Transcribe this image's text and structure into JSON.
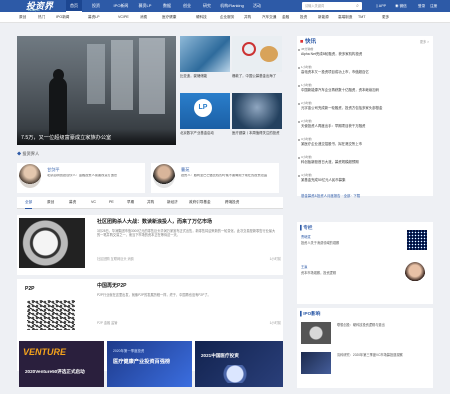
{
  "brand": {
    "logo_text": "投资界",
    "logo_sub": "PEdaily.cn"
  },
  "topnav": {
    "items": [
      "首页",
      "投资",
      "IPO新闻",
      "募资LP",
      "数据",
      "创业",
      "研究",
      "机构/Ranking",
      "活动"
    ],
    "active_index": 0,
    "search_placeholder": "请输入关键词",
    "app_label": "APP",
    "wechat_label": "微信",
    "login_label": "登录",
    "register_label": "注册"
  },
  "subnav": {
    "items": [
      "原创",
      "热门",
      "IPO新闻",
      "募资LP",
      "VC/PE",
      "消费",
      "医疗健康",
      "硬科技",
      "企业服务",
      "并购",
      "汽车交通",
      "金融",
      "投资",
      "新能源",
      "高端制造",
      "TMT",
      "更多"
    ]
  },
  "hero": {
    "caption": "7.5万，又一位超级富豪成立家族办公室"
  },
  "thumbs": [
    {
      "caption": "比亚迪，豪赌储能"
    },
    {
      "caption": "爆款了，中国公募基金出海了"
    },
    {
      "caption": "迈克尔乔丹，投资中国"
    },
    {
      "caption": "北京数字产业基金启动"
    },
    {
      "caption": "在苏州开，与LP学做资"
    },
    {
      "caption": "医疗健康丨本周值得关注的投资"
    }
  ],
  "section_title": "投资界人",
  "people": [
    {
      "name": "甘剑平",
      "desc": "北京启明创投合伙人：金融投资人需要改变打造思"
    },
    {
      "name": "曹苑",
      "desc": "投资人：跟阿里巴巴做比较的时候不要局限于现在的投资范围"
    }
  ],
  "tabs": {
    "items": [
      "全部",
      "原创",
      "募资",
      "VC",
      "PE",
      "早期",
      "并购",
      "新经济",
      "政府引导基金",
      "跨境投资"
    ],
    "active_index": 0
  },
  "articles": [
    {
      "title": "社区团购杀人大战：数读新浪投人，而来了万亿市场",
      "summary": "3月28日，华润集团市值3000亿元的零售巨头华润万家宣布正式出售，新零售将迎来新的一轮变化，此次交易是新零售行业最大的一笔并购交易之一，而当下市场的资本正在等待这一天。",
      "tags": "社区团购   互联网巨头   消费",
      "time": "1小时前"
    },
    {
      "title": "中国再无P2P",
      "summary": "P2P行业就在这里出发，就像P2P的发展历程一样，终于，中国再也没有P2P了。",
      "tags": "P2P   金融   监管",
      "time": "1小时前"
    }
  ],
  "banners": [
    {
      "text": "2020Venture50评选正式启动"
    },
    {
      "text": "2020年第一季度投资"
    },
    {
      "text": "医疗健康产业投资百强榜"
    },
    {
      "text": "2021中国医疗投资"
    }
  ],
  "flash": {
    "title": "快讯",
    "more": "更多 >",
    "items": [
      {
        "time": "45分钟前",
        "text": "Alpha Net完成B轮融资，获多家机构投资"
      },
      {
        "time": "1小时前",
        "text": "高瓴资本又一投资项目成功上市，市值超百亿"
      },
      {
        "time": "1小时前",
        "text": "中国新能源汽车企业再获数十亿融资，资本继续加码"
      },
      {
        "time": "2小时前",
        "text": "元宇宙公司完成新一轮融资，投资方包括多家头部基金"
      },
      {
        "time": "2小时前",
        "text": "天使投资人再度出手：早期项目获千万融资"
      },
      {
        "time": "3小时前",
        "text": "某医疗企业递交招股书，拟在港交所上市"
      },
      {
        "time": "3小时前",
        "text": "科创板新股首日大涨，募资规模超预期"
      },
      {
        "time": "4小时前",
        "text": "某基金完成50亿元人民币募集"
      }
    ],
    "footer": "基金募资&投资人月度报告 · 全部 · 下载"
  },
  "columns": {
    "title": "专栏",
    "items": [
      {
        "name": "曹继斌",
        "desc": "投资人关于消费领域的观察"
      },
      {
        "name": "王瀛",
        "desc": "资本市场观察，投资逻辑"
      }
    ]
  },
  "ipo": {
    "title": "IPO影响",
    "items": [
      {
        "text": "联想创投：硬科技投资逻辑与退出"
      },
      {
        "text": "清科研究：2020年第三季度VC市场募投退观察"
      }
    ]
  }
}
